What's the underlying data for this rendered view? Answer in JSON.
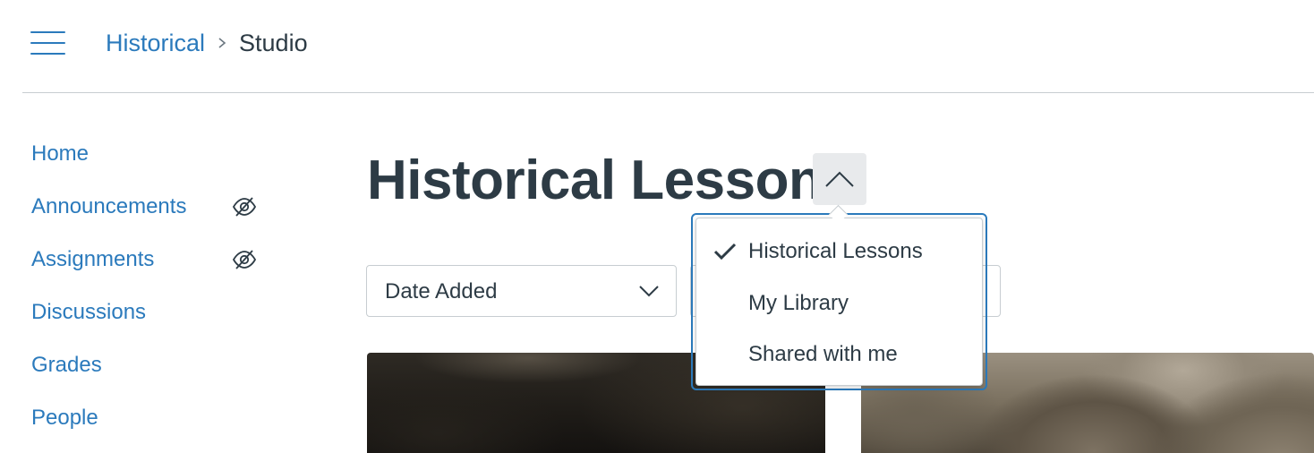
{
  "header": {
    "breadcrumb": {
      "course": "Historical",
      "current": "Studio"
    }
  },
  "sidebar": {
    "items": [
      {
        "label": "Home",
        "hidden": false
      },
      {
        "label": "Announcements",
        "hidden": true
      },
      {
        "label": "Assignments",
        "hidden": true
      },
      {
        "label": "Discussions",
        "hidden": false
      },
      {
        "label": "Grades",
        "hidden": false
      },
      {
        "label": "People",
        "hidden": false
      }
    ]
  },
  "main": {
    "title": "Historical Lessons",
    "sort": {
      "selected": "Date Added"
    }
  },
  "collection_menu": {
    "items": [
      {
        "label": "Historical Lessons",
        "selected": true
      },
      {
        "label": "My Library",
        "selected": false
      },
      {
        "label": "Shared with me",
        "selected": false
      }
    ]
  },
  "colors": {
    "link": "#2b7abc",
    "text": "#2d3b45",
    "border": "#c7cdd1"
  }
}
